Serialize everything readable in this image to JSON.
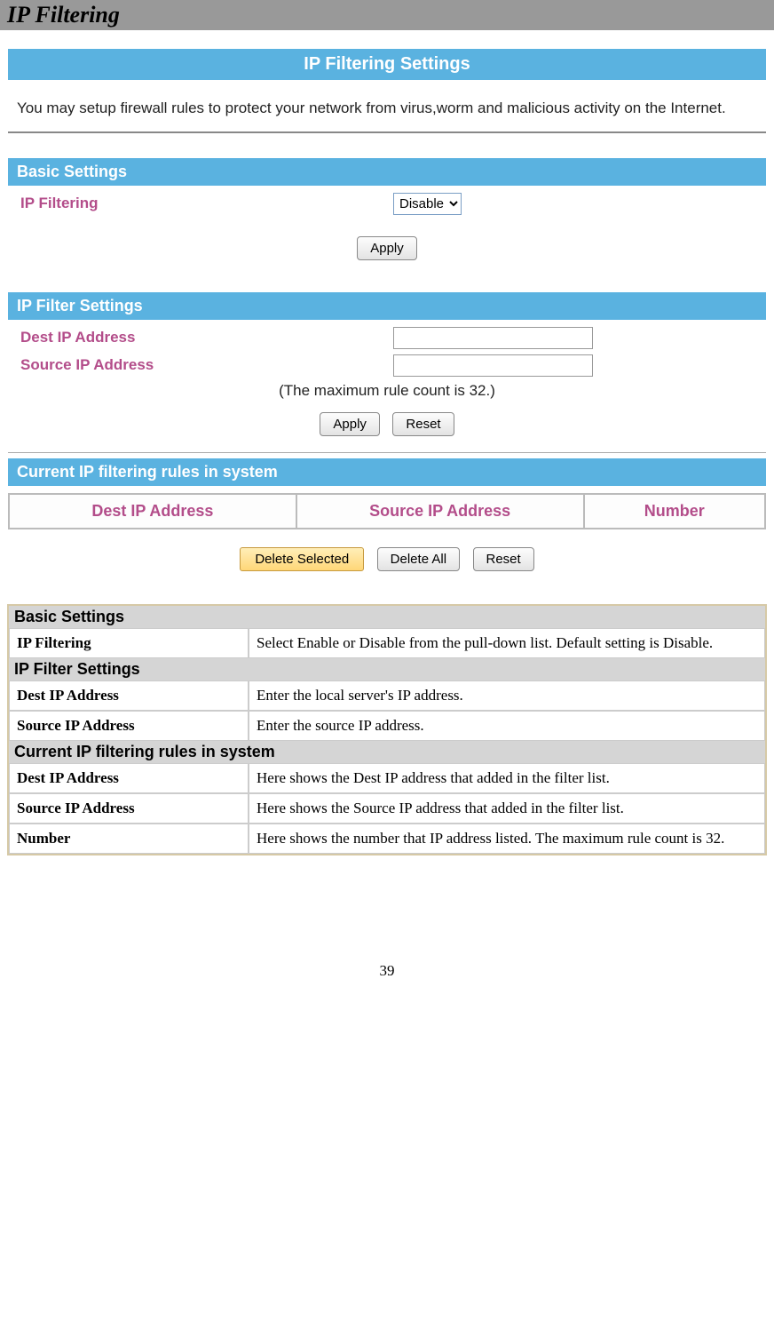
{
  "header": {
    "title": "IP Filtering"
  },
  "router": {
    "title": "IP Filtering Settings",
    "intro": "You may setup firewall rules to protect your network from virus,worm and malicious activity on the Internet.",
    "basic": {
      "section": "Basic Settings",
      "label": "IP Filtering",
      "value": "Disable",
      "apply": "Apply"
    },
    "filter": {
      "section": "IP Filter Settings",
      "dest_label": "Dest IP Address",
      "src_label": "Source IP Address",
      "hint": "(The maximum rule count is 32.)",
      "apply": "Apply",
      "reset": "Reset"
    },
    "rules": {
      "section": "Current IP filtering rules in system",
      "cols": {
        "dest": "Dest IP Address",
        "src": "Source IP Address",
        "num": "Number"
      }
    },
    "actions": {
      "del_sel": "Delete Selected",
      "del_all": "Delete All",
      "reset": "Reset"
    }
  },
  "desc": {
    "s1": "Basic Settings",
    "r1k": "IP Filtering",
    "r1v": "Select Enable or Disable from the pull-down list. Default setting is Disable.",
    "s2": "IP Filter Settings",
    "r2k": "Dest IP Address",
    "r2v": "Enter the local server's IP address.",
    "r3k": "Source IP Address",
    "r3v": "Enter the source IP address.",
    "s3": "Current IP filtering rules in system",
    "r4k": "Dest IP Address",
    "r4v": "Here shows the Dest IP address that added in the filter list.",
    "r5k": "Source IP Address",
    "r5v": "Here shows the Source IP address that added in the filter list.",
    "r6k": "Number",
    "r6v": "Here shows the number that IP address listed. The maximum rule count is 32."
  },
  "page_num": "39"
}
